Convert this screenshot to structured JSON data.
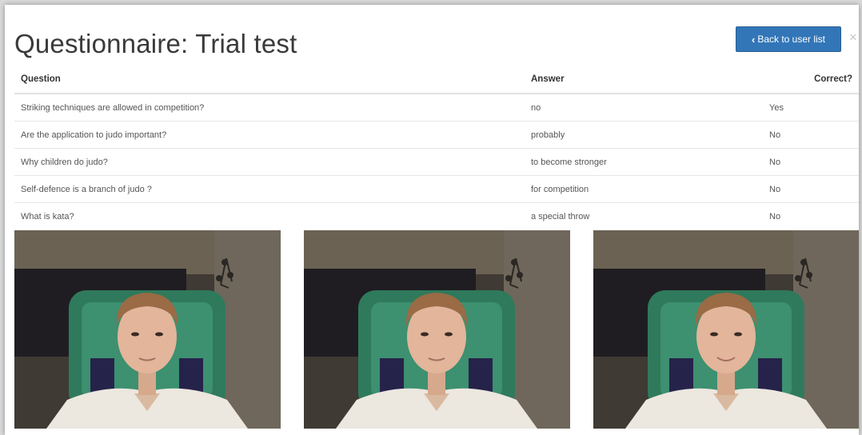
{
  "modal": {
    "title": "Questionnaire: Trial test",
    "back_button_label": "Back to user list",
    "close_glyph": "×"
  },
  "table": {
    "headers": [
      "Question",
      "Answer",
      "Correct?"
    ],
    "rows": [
      [
        "Striking techniques are allowed in competition?",
        "no",
        "Yes"
      ],
      [
        "Are the application to judo important?",
        "probably",
        "No"
      ],
      [
        "Why children do judo?",
        "to become stronger",
        "No"
      ],
      [
        "Self-defence is a branch of judo ?",
        "for competition",
        "No"
      ],
      [
        "What is kata?",
        "a special throw",
        "No"
      ]
    ]
  },
  "icons": {
    "back": "chevron-left-icon",
    "close": "close-icon"
  },
  "colors": {
    "accent": "#3276b8",
    "title_text": "#3a3a3a",
    "page_background": "#d9d9d9"
  }
}
